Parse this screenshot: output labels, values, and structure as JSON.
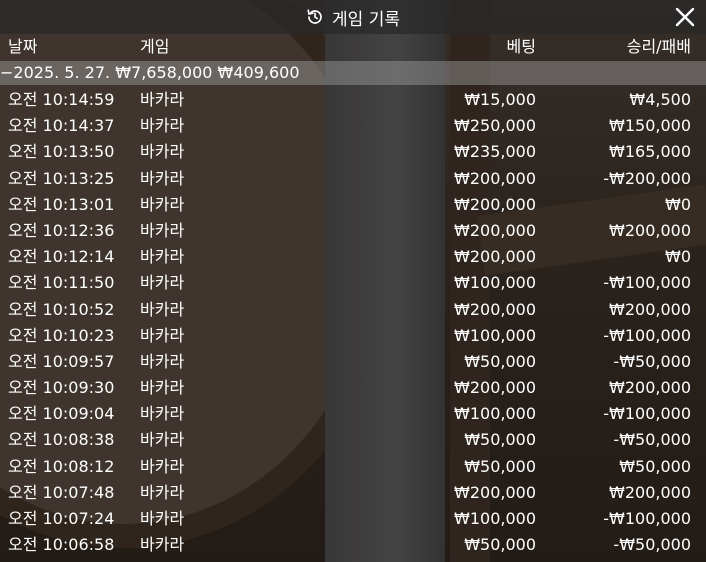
{
  "window": {
    "title": "게임 기록",
    "icon": "history-icon",
    "close_icon": "close-icon"
  },
  "columns": {
    "date": "날짜",
    "game": "게임",
    "bet": "베팅",
    "result": "승리/패배"
  },
  "date_group": {
    "date": "−2025. 5. 27.",
    "bet_total": "₩7,658,000",
    "result_total": "₩409,600"
  },
  "rows": [
    {
      "time": "오전 10:14:59",
      "game": "바카라",
      "bet": "₩15,000",
      "result": "₩4,500"
    },
    {
      "time": "오전 10:14:37",
      "game": "바카라",
      "bet": "₩250,000",
      "result": "₩150,000"
    },
    {
      "time": "오전 10:13:50",
      "game": "바카라",
      "bet": "₩235,000",
      "result": "₩165,000"
    },
    {
      "time": "오전 10:13:25",
      "game": "바카라",
      "bet": "₩200,000",
      "result": "-₩200,000"
    },
    {
      "time": "오전 10:13:01",
      "game": "바카라",
      "bet": "₩200,000",
      "result": "₩0"
    },
    {
      "time": "오전 10:12:36",
      "game": "바카라",
      "bet": "₩200,000",
      "result": "₩200,000"
    },
    {
      "time": "오전 10:12:14",
      "game": "바카라",
      "bet": "₩200,000",
      "result": "₩0"
    },
    {
      "time": "오전 10:11:50",
      "game": "바카라",
      "bet": "₩100,000",
      "result": "-₩100,000"
    },
    {
      "time": "오전 10:10:52",
      "game": "바카라",
      "bet": "₩200,000",
      "result": "₩200,000"
    },
    {
      "time": "오전 10:10:23",
      "game": "바카라",
      "bet": "₩100,000",
      "result": "-₩100,000"
    },
    {
      "time": "오전 10:09:57",
      "game": "바카라",
      "bet": "₩50,000",
      "result": "-₩50,000"
    },
    {
      "time": "오전 10:09:30",
      "game": "바카라",
      "bet": "₩200,000",
      "result": "₩200,000"
    },
    {
      "time": "오전 10:09:04",
      "game": "바카라",
      "bet": "₩100,000",
      "result": "-₩100,000"
    },
    {
      "time": "오전 10:08:38",
      "game": "바카라",
      "bet": "₩50,000",
      "result": "-₩50,000"
    },
    {
      "time": "오전 10:08:12",
      "game": "바카라",
      "bet": "₩50,000",
      "result": "₩50,000"
    },
    {
      "time": "오전 10:07:48",
      "game": "바카라",
      "bet": "₩200,000",
      "result": "₩200,000"
    },
    {
      "time": "오전 10:07:24",
      "game": "바카라",
      "bet": "₩100,000",
      "result": "-₩100,000"
    },
    {
      "time": "오전 10:06:58",
      "game": "바카라",
      "bet": "₩50,000",
      "result": "-₩50,000"
    }
  ]
}
